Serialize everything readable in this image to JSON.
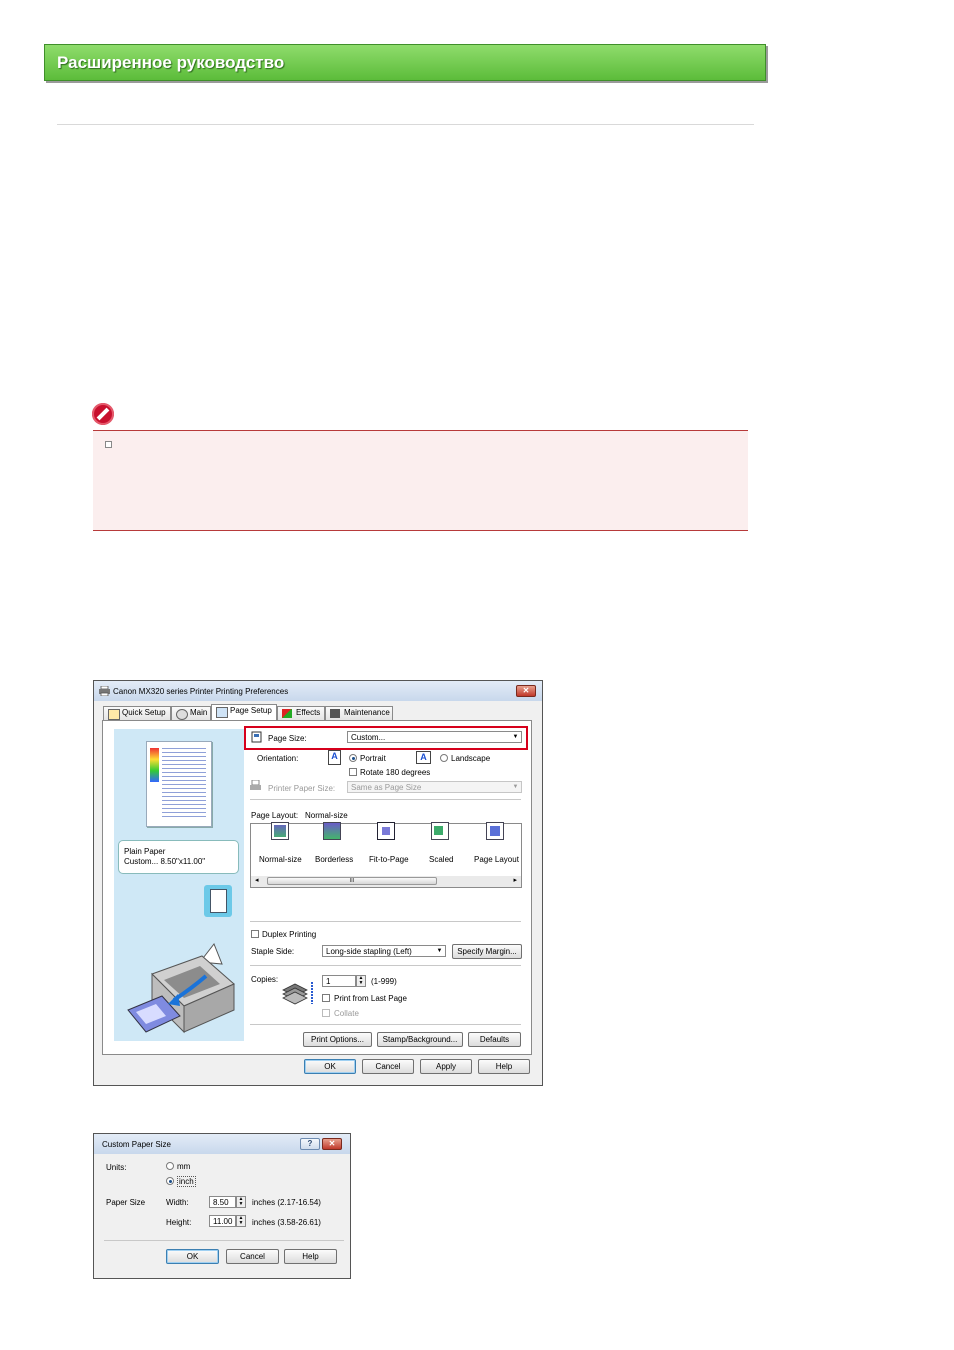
{
  "header": {
    "title": "Расширенное руководство"
  },
  "preferences_dialog": {
    "title": "Canon MX320 series Printer Printing Preferences",
    "close_glyph": "✕",
    "tabs": [
      {
        "label": "Quick Setup",
        "icon": "quick-setup-icon"
      },
      {
        "label": "Main",
        "icon": "main-icon"
      },
      {
        "label": "Page Setup",
        "icon": "page-setup-icon"
      },
      {
        "label": "Effects",
        "icon": "effects-icon"
      },
      {
        "label": "Maintenance",
        "icon": "maintenance-icon"
      }
    ],
    "preview_info": {
      "media": "Plain Paper",
      "size": "Custom... 8.50\"x11.00\""
    },
    "page_size_label": "Page Size:",
    "page_size_value": "Custom...",
    "orientation_label": "Orientation:",
    "portrait_label": "Portrait",
    "landscape_label": "Landscape",
    "orientation_icon_glyph": "A",
    "rotate_label": "Rotate 180 degrees",
    "printer_paper_size_label": "Printer Paper Size:",
    "printer_paper_size_value": "Same as Page Size",
    "page_layout_label": "Page Layout:",
    "page_layout_value": "Normal-size",
    "layouts": [
      "Normal-size",
      "Borderless",
      "Fit-to-Page",
      "Scaled",
      "Page Layout"
    ],
    "scroll_thumb_glyph": "III",
    "duplex_label": "Duplex Printing",
    "staple_side_label": "Staple Side:",
    "staple_side_value": "Long-side stapling (Left)",
    "specify_margin_label": "Specify Margin...",
    "copies_label": "Copies:",
    "copies_value": "1",
    "copies_range": "(1-999)",
    "print_last_label": "Print from Last Page",
    "collate_label": "Collate",
    "print_options_label": "Print Options...",
    "stamp_background_label": "Stamp/Background...",
    "defaults_label": "Defaults",
    "ok_label": "OK",
    "cancel_label": "Cancel",
    "apply_label": "Apply",
    "help_label": "Help"
  },
  "custom_dialog": {
    "title": "Custom Paper Size",
    "help_glyph": "?",
    "close_glyph": "✕",
    "units_label": "Units:",
    "mm_label": "mm",
    "inch_label": "inch",
    "paper_size_label": "Paper Size",
    "width_label": "Width:",
    "width_value": "8.50",
    "width_range": "inches (2.17-16.54)",
    "height_label": "Height:",
    "height_value": "11.00",
    "height_range": "inches (3.58-26.61)",
    "ok_label": "OK",
    "cancel_label": "Cancel",
    "help_label": "Help"
  },
  "colors": {
    "banner": "#5cbc3a",
    "notice_bg": "#fbeeee",
    "notice_border": "#b73a3a",
    "highlight": "#d6001c",
    "preview_panel": "#cfe8f6"
  }
}
